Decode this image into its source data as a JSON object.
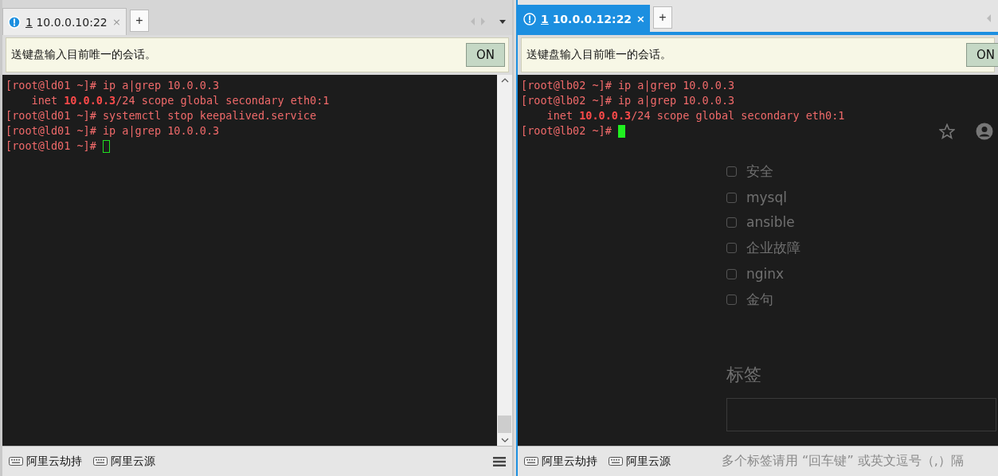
{
  "panes": [
    {
      "active": false,
      "tab": {
        "number": "1",
        "label": "10.0.0.10:22",
        "close": "×"
      },
      "add_tab": "+",
      "notice": "送键盘输入目前唯一的会话。",
      "on_button": "ON",
      "lines": [
        "[root@ld01 ~]# ip a|grep 10.0.0.3",
        "    inet **10.0.0.3**/24 scope global secondary eth0:1",
        "[root@ld01 ~]# systemctl stop keepalived.service",
        "[root@ld01 ~]# ip a|grep 10.0.0.3"
      ],
      "prompt": "[root@ld01 ~]# ",
      "quick_commands": [
        "阿里云劫持",
        "阿里云源"
      ]
    },
    {
      "active": true,
      "tab": {
        "number": "1",
        "label": "10.0.0.12:22",
        "close": "×"
      },
      "add_tab": "+",
      "notice": "送键盘输入目前唯一的会话。",
      "on_button": "ON",
      "lines": [
        "[root@lb02 ~]# ip a|grep 10.0.0.3",
        "[root@lb02 ~]# ip a|grep 10.0.0.3",
        "    inet **10.0.0.3**/24 scope global secondary eth0:1"
      ],
      "prompt": "[root@lb02 ~]# ",
      "quick_commands": [
        "阿里云劫持",
        "阿里云源"
      ],
      "background_page": {
        "checkbox_items": [
          {
            "label": "安全",
            "checked": false
          },
          {
            "label": "mysql",
            "checked": false
          },
          {
            "label": "ansible",
            "checked": false
          },
          {
            "label": "企业故障",
            "checked": false
          },
          {
            "label": "nginx",
            "checked": false
          },
          {
            "label": "金句",
            "checked": false
          }
        ],
        "heading": "标签",
        "hint": "多个标签请用 “回车键” 或英文逗号（,）隔"
      }
    }
  ]
}
